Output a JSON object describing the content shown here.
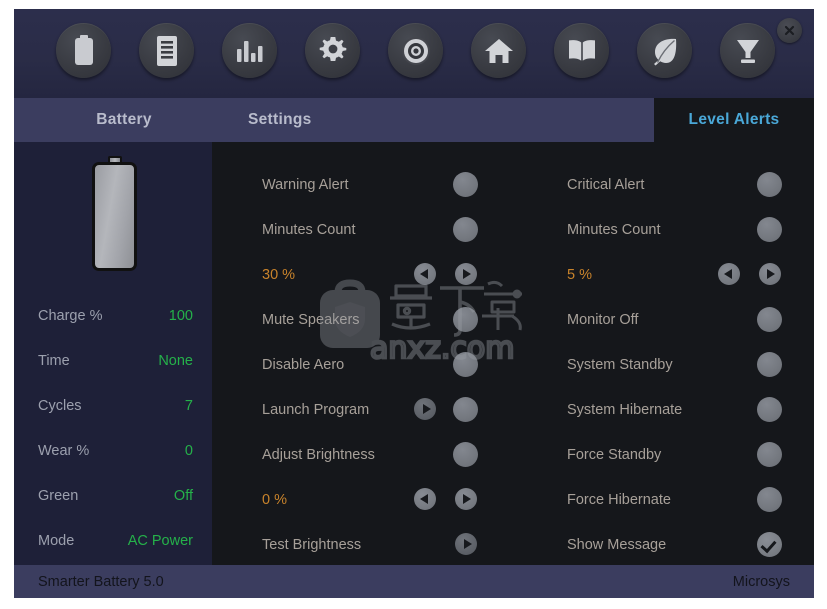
{
  "window": {
    "close_label": "×",
    "accent_color": "#4aa8d8",
    "tabbar_color": "#3b3d5f",
    "panel_color": "#15171b",
    "sidebar_color": "#1e2038",
    "value_green": "#25b14a",
    "percent_orange": "#c8832b"
  },
  "toolbar": {
    "icons": [
      {
        "name": "battery-icon",
        "title": "Battery"
      },
      {
        "name": "report-icon",
        "title": "Report"
      },
      {
        "name": "chart-icon",
        "title": "Statistics"
      },
      {
        "name": "gear-icon",
        "title": "Settings"
      },
      {
        "name": "target-icon",
        "title": "Calibration"
      },
      {
        "name": "home-icon",
        "title": "Home"
      },
      {
        "name": "book-icon",
        "title": "Help"
      },
      {
        "name": "leaf-icon",
        "title": "Green Mode"
      },
      {
        "name": "funnel-icon",
        "title": "Discharge"
      }
    ]
  },
  "tabs": [
    {
      "label": "Battery",
      "active": false
    },
    {
      "label": "Settings",
      "active": false
    },
    {
      "label": "Level Alerts",
      "active": true
    }
  ],
  "sidebar": {
    "battery_icon": "battery-full-icon",
    "stats": [
      {
        "label": "Charge %",
        "value": "100"
      },
      {
        "label": "Time",
        "value": "None"
      },
      {
        "label": "Cycles",
        "value": "7"
      },
      {
        "label": "Wear %",
        "value": "0"
      },
      {
        "label": "Green",
        "value": "Off"
      },
      {
        "label": "Mode",
        "value": "AC Power"
      }
    ]
  },
  "alerts": {
    "left_column": [
      {
        "label": "Warning Alert",
        "control": "toggle",
        "checked": false
      },
      {
        "label": "Minutes Count",
        "control": "toggle",
        "checked": false
      },
      {
        "label": "30 %",
        "control": "spinner",
        "percent": true
      },
      {
        "label": "Mute Speakers",
        "control": "toggle",
        "checked": false
      },
      {
        "label": "Disable Aero",
        "control": "toggle",
        "checked": false
      },
      {
        "label": "Launch Program",
        "control": "play-toggle",
        "checked": false
      },
      {
        "label": "Adjust Brightness",
        "control": "toggle",
        "checked": false
      },
      {
        "label": "0 %",
        "control": "spinner",
        "percent": true
      },
      {
        "label": "Test Brightness",
        "control": "play"
      }
    ],
    "right_column": [
      {
        "label": "Critical Alert",
        "control": "toggle",
        "checked": false
      },
      {
        "label": "Minutes Count",
        "control": "toggle",
        "checked": false
      },
      {
        "label": "5 %",
        "control": "spinner",
        "percent": true
      },
      {
        "label": "Monitor Off",
        "control": "toggle",
        "checked": false
      },
      {
        "label": "System Standby",
        "control": "toggle",
        "checked": false
      },
      {
        "label": "System Hibernate",
        "control": "toggle",
        "checked": false
      },
      {
        "label": "Force Standby",
        "control": "toggle",
        "checked": false
      },
      {
        "label": "Force Hibernate",
        "control": "toggle",
        "checked": false
      },
      {
        "label": "Show Message",
        "control": "toggle",
        "checked": true
      }
    ]
  },
  "watermark": {
    "text": "anxz.com",
    "logo": "anxz-shield-bag-logo"
  },
  "statusbar": {
    "left": "Smarter Battery 5.0",
    "right": "Microsys"
  }
}
